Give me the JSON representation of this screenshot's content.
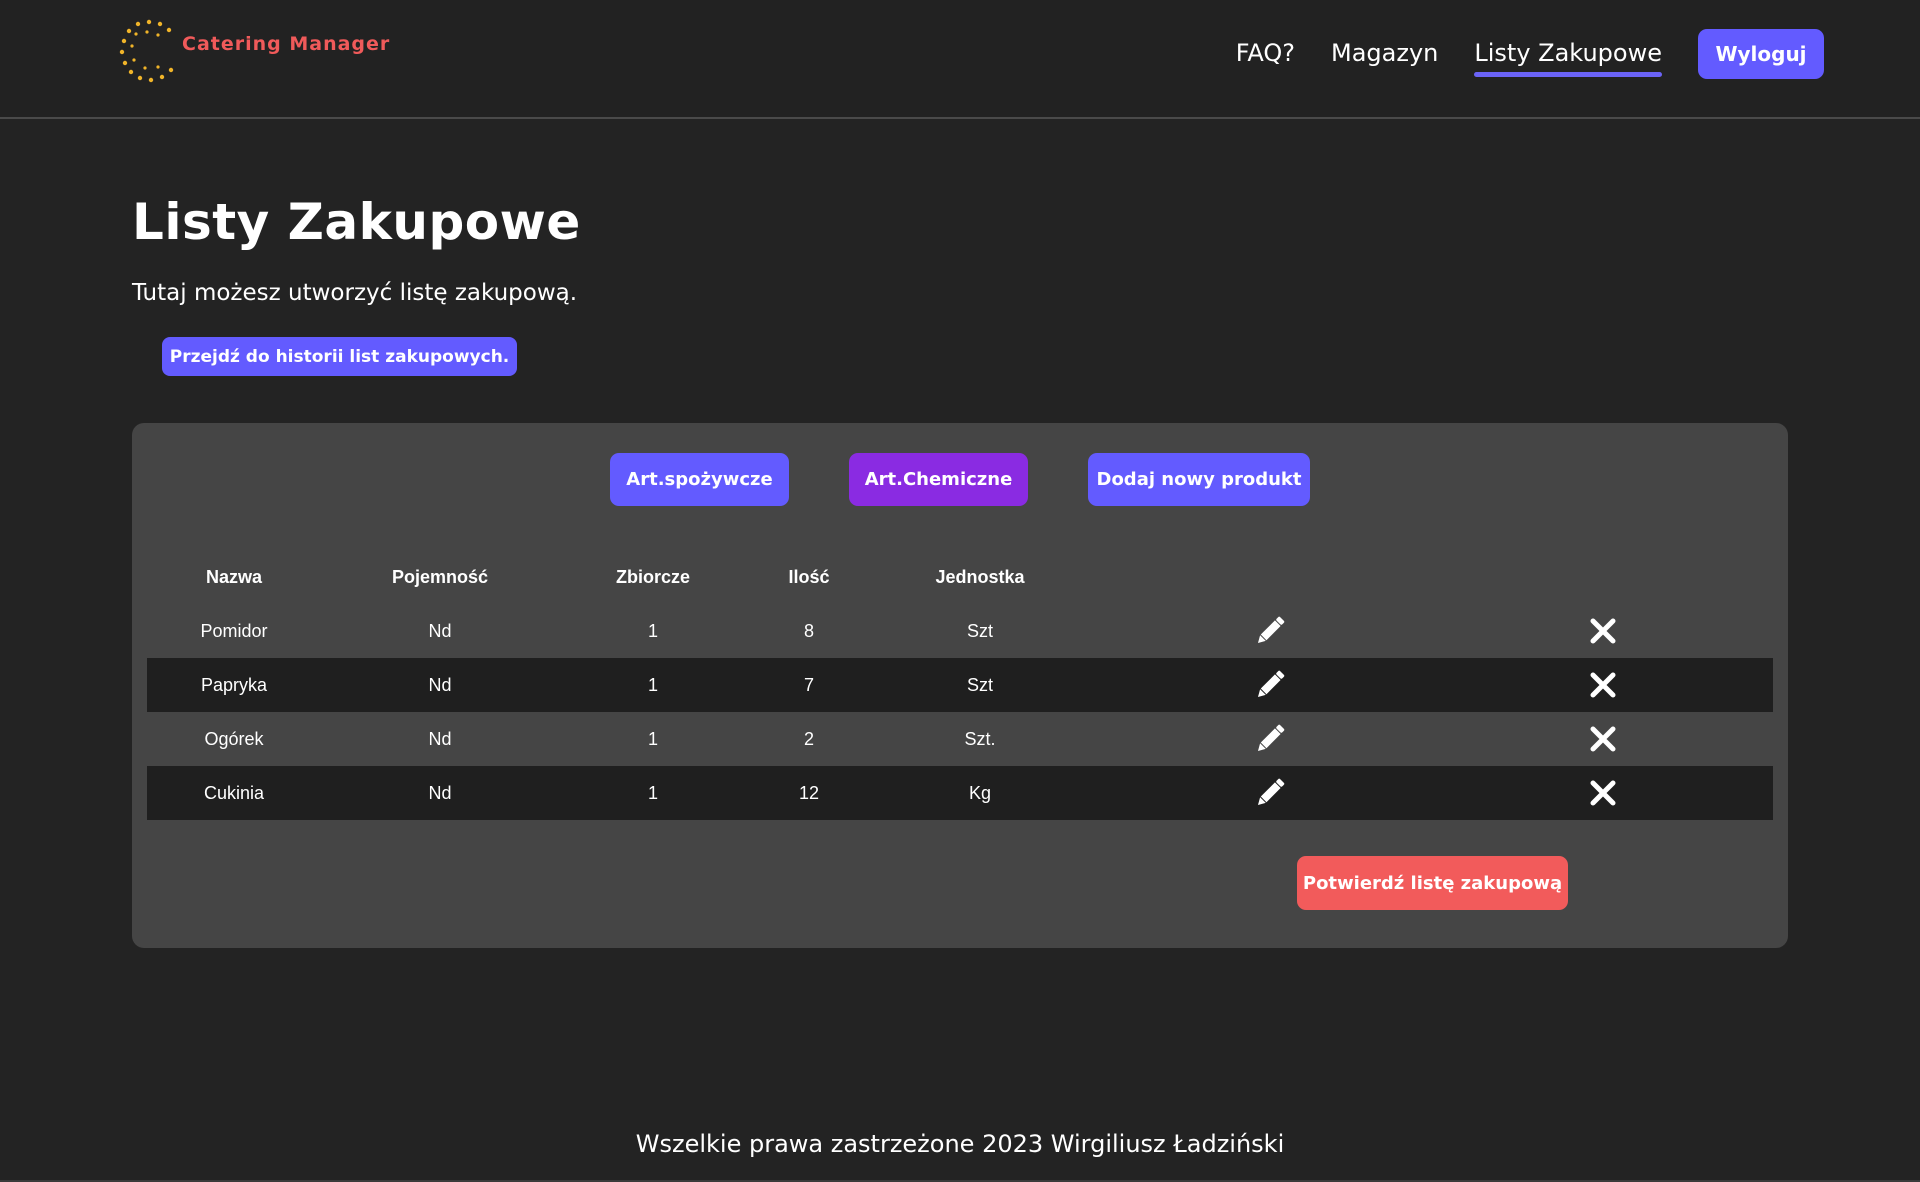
{
  "header": {
    "logo_text": "Catering Manager",
    "nav": [
      {
        "label": "FAQ?",
        "active": false
      },
      {
        "label": "Magazyn",
        "active": false
      },
      {
        "label": "Listy Zakupowe",
        "active": true
      }
    ],
    "logout_label": "Wyloguj"
  },
  "page": {
    "title": "Listy Zakupowe",
    "subtitle": "Tutaj możesz utworzyć listę zakupową.",
    "history_button": "Przejdź do historii list zakupowych."
  },
  "panel": {
    "category_buttons": {
      "food": "Art.spożywcze",
      "chemical": "Art.Chemiczne",
      "add_product": "Dodaj nowy produkt"
    },
    "table": {
      "headers": {
        "name": "Nazwa",
        "capacity": "Pojemność",
        "bulk": "Zbiorcze",
        "quantity": "Ilość",
        "unit": "Jednostka"
      },
      "rows": [
        {
          "name": "Pomidor",
          "capacity": "Nd",
          "bulk": "1",
          "quantity": "8",
          "unit": "Szt"
        },
        {
          "name": "Papryka",
          "capacity": "Nd",
          "bulk": "1",
          "quantity": "7",
          "unit": "Szt"
        },
        {
          "name": "Ogórek",
          "capacity": "Nd",
          "bulk": "1",
          "quantity": "2",
          "unit": "Szt."
        },
        {
          "name": "Cukinia",
          "capacity": "Nd",
          "bulk": "1",
          "quantity": "12",
          "unit": "Kg"
        }
      ],
      "row_icons": {
        "edit": "pencil-icon",
        "delete": "close-icon"
      }
    },
    "confirm_button": "Potwierdź listę zakupową"
  },
  "footer": {
    "text": "Wszelkie prawa zastrzeżone 2023 Wirgiliusz Ładziński"
  },
  "colors": {
    "background": "#232323",
    "panel": "#454545",
    "accent": "#635bff",
    "chemical_accent": "#8a2be2",
    "confirm": "#f25b5b",
    "logo_text": "#f05a5a",
    "logo_dots": "#f0b429"
  }
}
